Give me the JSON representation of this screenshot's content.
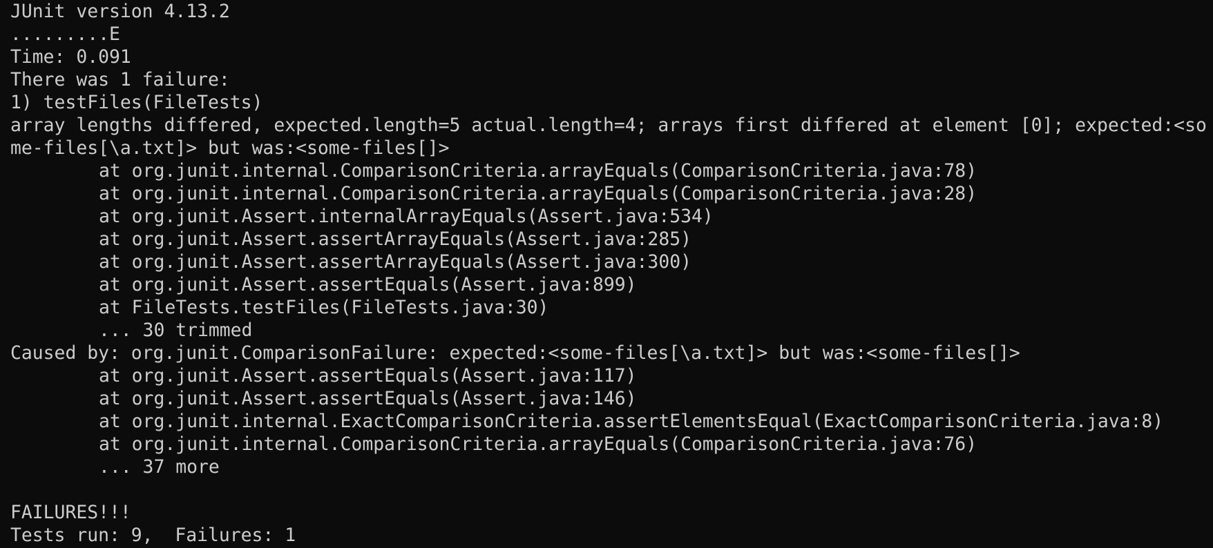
{
  "terminal": {
    "header": "JUnit version 4.13.2",
    "progress": ".........E",
    "time": "Time: 0.091",
    "summary_line": "There was 1 failure:",
    "failure_title": "1) testFiles(FileTests)",
    "failure_message": "array lengths differed, expected.length=5 actual.length=4; arrays first differed at element [0]; expected:<some-files[\\a.txt]> but was:<some-files[]>",
    "stack_1": [
      "at org.junit.internal.ComparisonCriteria.arrayEquals(ComparisonCriteria.java:78)",
      "at org.junit.internal.ComparisonCriteria.arrayEquals(ComparisonCriteria.java:28)",
      "at org.junit.Assert.internalArrayEquals(Assert.java:534)",
      "at org.junit.Assert.assertArrayEquals(Assert.java:285)",
      "at org.junit.Assert.assertArrayEquals(Assert.java:300)",
      "at org.junit.Assert.assertEquals(Assert.java:899)",
      "at FileTests.testFiles(FileTests.java:30)",
      "... 30 trimmed"
    ],
    "caused_by": "Caused by: org.junit.ComparisonFailure: expected:<some-files[\\a.txt]> but was:<some-files[]>",
    "stack_2": [
      "at org.junit.Assert.assertEquals(Assert.java:117)",
      "at org.junit.Assert.assertEquals(Assert.java:146)",
      "at org.junit.internal.ExactComparisonCriteria.assertElementsEqual(ExactComparisonCriteria.java:8)",
      "at org.junit.internal.ComparisonCriteria.arrayEquals(ComparisonCriteria.java:76)",
      "... 37 more"
    ],
    "failures_banner": "FAILURES!!!",
    "tests_run": "Tests run: 9,  Failures: 1"
  }
}
